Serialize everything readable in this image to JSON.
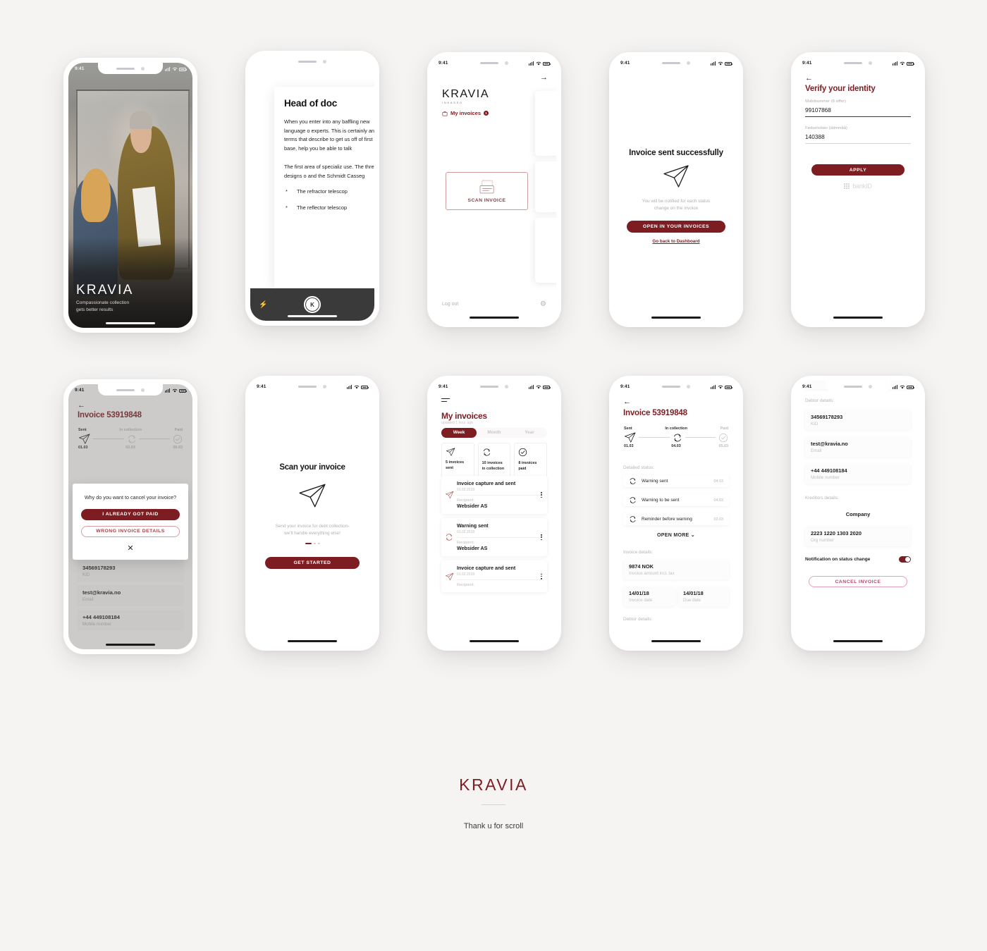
{
  "brand": {
    "name": "KRAVIA",
    "tagline": "INKASSO",
    "primary_color": "#7d1d22",
    "pink_color": "#c1436a"
  },
  "status_bar": {
    "time": "9:41"
  },
  "screens": {
    "onboarding_photo": {
      "logo": "KRAVIA",
      "tagline_line1": "Compassionate collection",
      "tagline_line2": "gets better results"
    },
    "document_scan": {
      "heading": "Head of doc",
      "paragraph1": "When you enter into any baffling new language o experts. This is certainly and terms that describe to get us off of first base, help you be able to talk ",
      "paragraph2": "The first area of specializ use. The three designs o and the Schmidt Casseg",
      "bullet1": "The refractor telescop",
      "bullet2": "The reflector telescop",
      "shutter_label": "K",
      "flash_icon": "flash-icon"
    },
    "dashboard": {
      "logo": "KRAVIA",
      "tagline": "INKASSO",
      "my_invoices_label": "My invoices",
      "badge_count": "1",
      "scan_button_label": "SCAN INVOICE",
      "logout_label": "Log out",
      "settings_icon": "gear-icon",
      "forward_icon": "arrow-right-icon"
    },
    "success": {
      "title": "Invoice sent successfully",
      "subtitle_line1": "You will be notified for each status",
      "subtitle_line2": "change on the invoice",
      "primary_button": "OPEN IN YOUR INVOICES",
      "link": "Go back to Dashboard",
      "icon": "paper-plane-icon"
    },
    "verify_identity": {
      "title": "Verify your identity",
      "field_mobile_label": "Mobilnummer (8 siffer)",
      "field_mobile_value": "99107868",
      "field_birth_label": "Fødselsdato (ddmmåå)",
      "field_birth_value": "140388",
      "apply_button": "APPLY",
      "bankid_label": "bankID"
    },
    "cancel_modal": {
      "title": "Invoice 53919848",
      "tracker": {
        "steps": [
          {
            "label": "Sent",
            "date": "01.03",
            "active": true
          },
          {
            "label": "In collection",
            "date": "02.03",
            "active": false
          },
          {
            "label": "Paid",
            "date": "05.03",
            "active": false
          }
        ]
      },
      "question": "Why do you want to cancel your invoice?",
      "option_paid": "I ALREADY GOT PAID",
      "option_wrong": "WRONG INVOICE DETAILS",
      "close_icon": "close-icon",
      "behind_fields": [
        {
          "value": "34569178293",
          "key": "KID"
        },
        {
          "value": "test@kravia.no",
          "key": "Email"
        },
        {
          "value": "+44 449108184",
          "key": "Mobile number"
        }
      ]
    },
    "scan_onboarding": {
      "title": "Scan your invoice",
      "subtitle_line1": "Send your invoice for debt collection-",
      "subtitle_line2": "we'll handle everything else!",
      "button": "GET STARTED",
      "icon": "paper-plane-icon",
      "dots_total": 3,
      "dots_active_index": 0
    },
    "my_invoices": {
      "menu_icon": "hamburger-icon",
      "title": "My invoices",
      "subtitle": "updated 1 hour ago",
      "segments": [
        "Week",
        "Month",
        "Year"
      ],
      "segment_active": "Week",
      "stats": [
        {
          "icon": "paper-plane-icon",
          "line1": "5 invoices",
          "line2": "sent"
        },
        {
          "icon": "refresh-icon",
          "line1": "10 invoices",
          "line2": "in collection"
        },
        {
          "icon": "check-circle-icon",
          "line1": "8 invoices",
          "line2": "paid"
        }
      ],
      "recipient_label": "Recipient:",
      "items": [
        {
          "title": "Invoice capture and sent",
          "date": "01.02.2018",
          "recipient": "Websider AS",
          "icon": "paper-plane-icon"
        },
        {
          "title": "Warning sent",
          "date": "01.02.2018",
          "recipient": "Websider AS",
          "icon": "refresh-icon"
        },
        {
          "title": "Invoice capture and sent",
          "date": "01.02.2018",
          "recipient": "",
          "icon": "paper-plane-icon"
        }
      ]
    },
    "invoice_detail": {
      "menu_icon": "hamburger-icon",
      "title": "Invoice 53919848",
      "tracker": {
        "steps": [
          {
            "label": "Sent",
            "date": "01.03",
            "active": true
          },
          {
            "label": "In collection",
            "date": "04.03",
            "active": true
          },
          {
            "label": "Paid",
            "date": "05.03",
            "active": false
          }
        ]
      },
      "detailed_status_label": "Detailed status:",
      "status_rows": [
        {
          "name": "Warning sent",
          "date": "04.03",
          "icon": "refresh-icon"
        },
        {
          "name": "Warning to be sent",
          "date": "04.03",
          "icon": "refresh-icon"
        },
        {
          "name": "Reminder before warning",
          "date": "02.03",
          "icon": "refresh-icon"
        }
      ],
      "open_more": "OPEN MORE",
      "invoice_details_label": "Invoice details:",
      "amount_value": "9874 NOK",
      "amount_key": "Invoice amount incl. tax",
      "invoice_date_value": "14/01/18",
      "invoice_date_key": "Invoice date",
      "due_date_value": "14/01/18",
      "due_date_key": "Due date",
      "debtor_details_label": "Debtor details:"
    },
    "debtor_details": {
      "debtor_label": "Debtor details:",
      "fields": [
        {
          "value": "34569178293",
          "key": "KID"
        },
        {
          "value": "test@kravia.no",
          "key": "Email"
        },
        {
          "value": "+44 449108184",
          "key": "Mobile number"
        }
      ],
      "kreditors_label": "Kreditors details:",
      "company": "Company",
      "org_value": "2223 1220 1303 2020",
      "org_key": "Org number",
      "notification_label": "Notification on status change",
      "notification_on": true,
      "cancel_button": "CANCEL INVOICE"
    }
  },
  "footer": {
    "logo": "KRAVIA",
    "thanks": "Thank u for scroll"
  }
}
